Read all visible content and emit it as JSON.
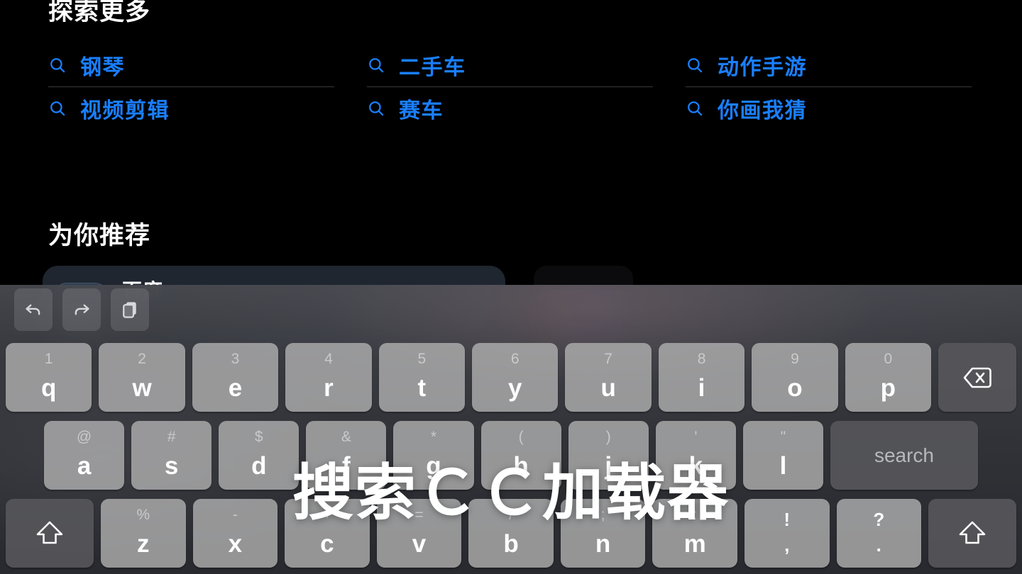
{
  "colors": {
    "background": "#000000",
    "link_blue": "#1a7fff",
    "divider": "#3a3a3c",
    "key_light": "#b0b0b0",
    "key_dark": "#56565a",
    "text_white": "#ffffff"
  },
  "page": {
    "explore_title": "探索更多",
    "recommend_title": "为你推荐",
    "suggestions": [
      {
        "label": "钢琴",
        "icon": "search-icon",
        "divider": true
      },
      {
        "label": "二手车",
        "icon": "search-icon",
        "divider": true
      },
      {
        "label": "动作手游",
        "icon": "search-icon",
        "divider": true
      },
      {
        "label": "视频剪辑",
        "icon": "search-icon",
        "divider": false
      },
      {
        "label": "赛车",
        "icon": "search-icon",
        "divider": false
      },
      {
        "label": "你画我猜",
        "icon": "search-icon",
        "divider": false
      }
    ],
    "recommend_cards": [
      {
        "app_name": "百度",
        "icon": "app-icon"
      },
      {
        "app_name": "",
        "icon": "thumbnail-gradient"
      }
    ]
  },
  "keyboard": {
    "toolbar": [
      {
        "name": "undo-icon",
        "label": "undo"
      },
      {
        "name": "redo-icon",
        "label": "redo"
      },
      {
        "name": "paste-icon",
        "label": "paste"
      }
    ],
    "row1": [
      {
        "hint": "1",
        "main": "q"
      },
      {
        "hint": "2",
        "main": "w"
      },
      {
        "hint": "3",
        "main": "e"
      },
      {
        "hint": "4",
        "main": "r"
      },
      {
        "hint": "5",
        "main": "t"
      },
      {
        "hint": "6",
        "main": "y"
      },
      {
        "hint": "7",
        "main": "u"
      },
      {
        "hint": "8",
        "main": "i"
      },
      {
        "hint": "9",
        "main": "o"
      },
      {
        "hint": "0",
        "main": "p"
      }
    ],
    "backspace_label": "backspace",
    "row2": [
      {
        "hint": "@",
        "main": "a"
      },
      {
        "hint": "#",
        "main": "s"
      },
      {
        "hint": "$",
        "main": "d"
      },
      {
        "hint": "&",
        "main": "f"
      },
      {
        "hint": "*",
        "main": "g"
      },
      {
        "hint": "(",
        "main": "h"
      },
      {
        "hint": ")",
        "main": "j"
      },
      {
        "hint": "'",
        "main": "k"
      },
      {
        "hint": "\"",
        "main": "l"
      }
    ],
    "search_label": "search",
    "row3": [
      {
        "hint": "%",
        "main": "z"
      },
      {
        "hint": "-",
        "main": "x"
      },
      {
        "hint": "+",
        "main": "c"
      },
      {
        "hint": "=",
        "main": "v"
      },
      {
        "hint": "/",
        "main": "b"
      },
      {
        "hint": ";",
        "main": "n"
      },
      {
        "hint": ":",
        "main": "m"
      }
    ],
    "row3_punct": [
      {
        "hint": "!",
        "main": ","
      },
      {
        "hint": "?",
        "main": "."
      }
    ],
    "shift_left_label": "shift",
    "shift_right_label": "shift"
  },
  "overlay": {
    "caption": "搜索ＣＣ加载器"
  }
}
